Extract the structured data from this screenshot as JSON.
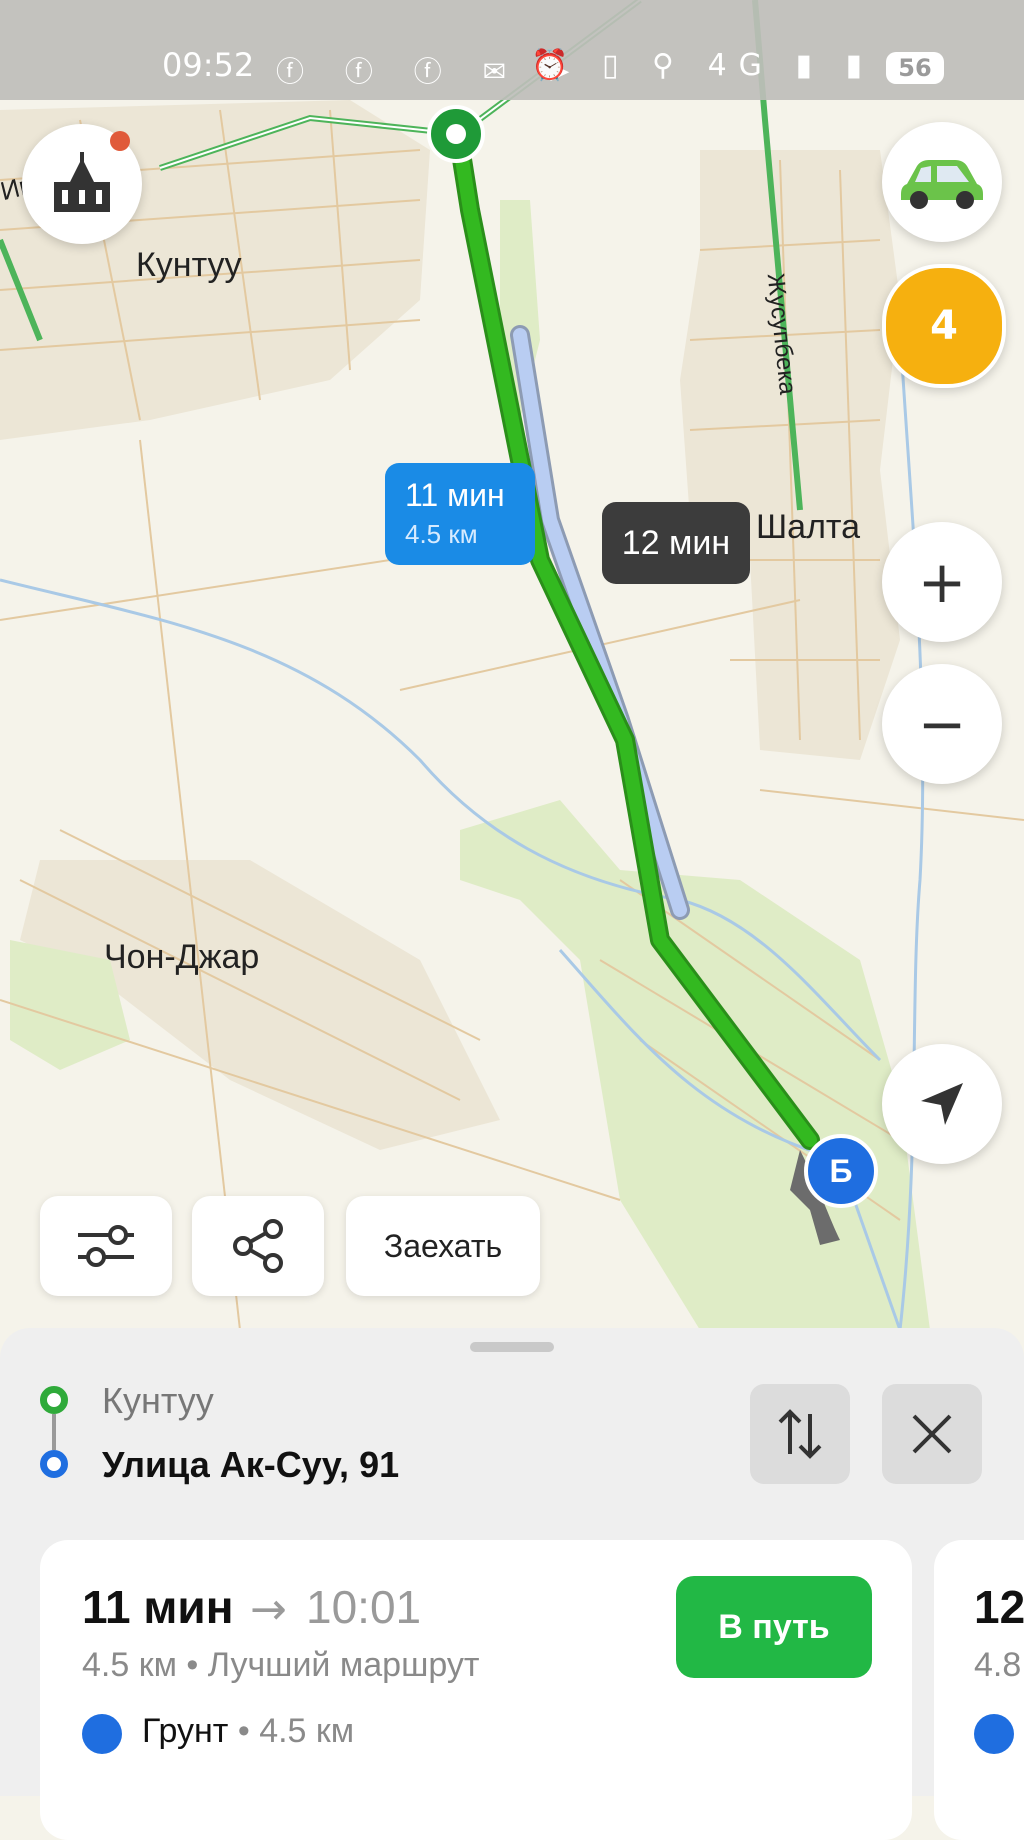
{
  "status_bar": {
    "time": "09:52",
    "app_icons": "ⓕ ⓕ ⓕ ✉ ➤",
    "system_icons": "⏰ ▯ ⚲ 4G ▮ ▮",
    "battery": "56"
  },
  "map": {
    "places": {
      "kuntuu": "Кунтуу",
      "shalta": "Шалта",
      "chon_djar": "Чон-Джар",
      "street_top_left": "Им    ва",
      "street_right": "Жусупбека"
    },
    "route_bubble_primary": {
      "time": "11 мин",
      "distance": "4.5 км"
    },
    "route_bubble_alt": {
      "time": "12 мин"
    },
    "destination_marker": "Б",
    "badge_count": "4",
    "controls": {
      "zoom_in": "+",
      "zoom_out": "−"
    },
    "tools": {
      "drive_through_label": "Заехать"
    },
    "colors": {
      "route": "#33b920",
      "alt_route": "#b9cdf2",
      "primary_bubble": "#1a8be6",
      "go_button": "#22b845"
    }
  },
  "route_panel": {
    "from": "Кунтуу",
    "to": "Улица Ак-Суу, 91"
  },
  "routes": [
    {
      "duration": "11 мин",
      "arrival": "10:01",
      "summary": "4.5 км • Лучший маршрут",
      "road_type": "Грунт",
      "road_distance": "• 4.5 км",
      "go_label": "В путь"
    },
    {
      "duration": "12",
      "summary": "4.8"
    }
  ]
}
